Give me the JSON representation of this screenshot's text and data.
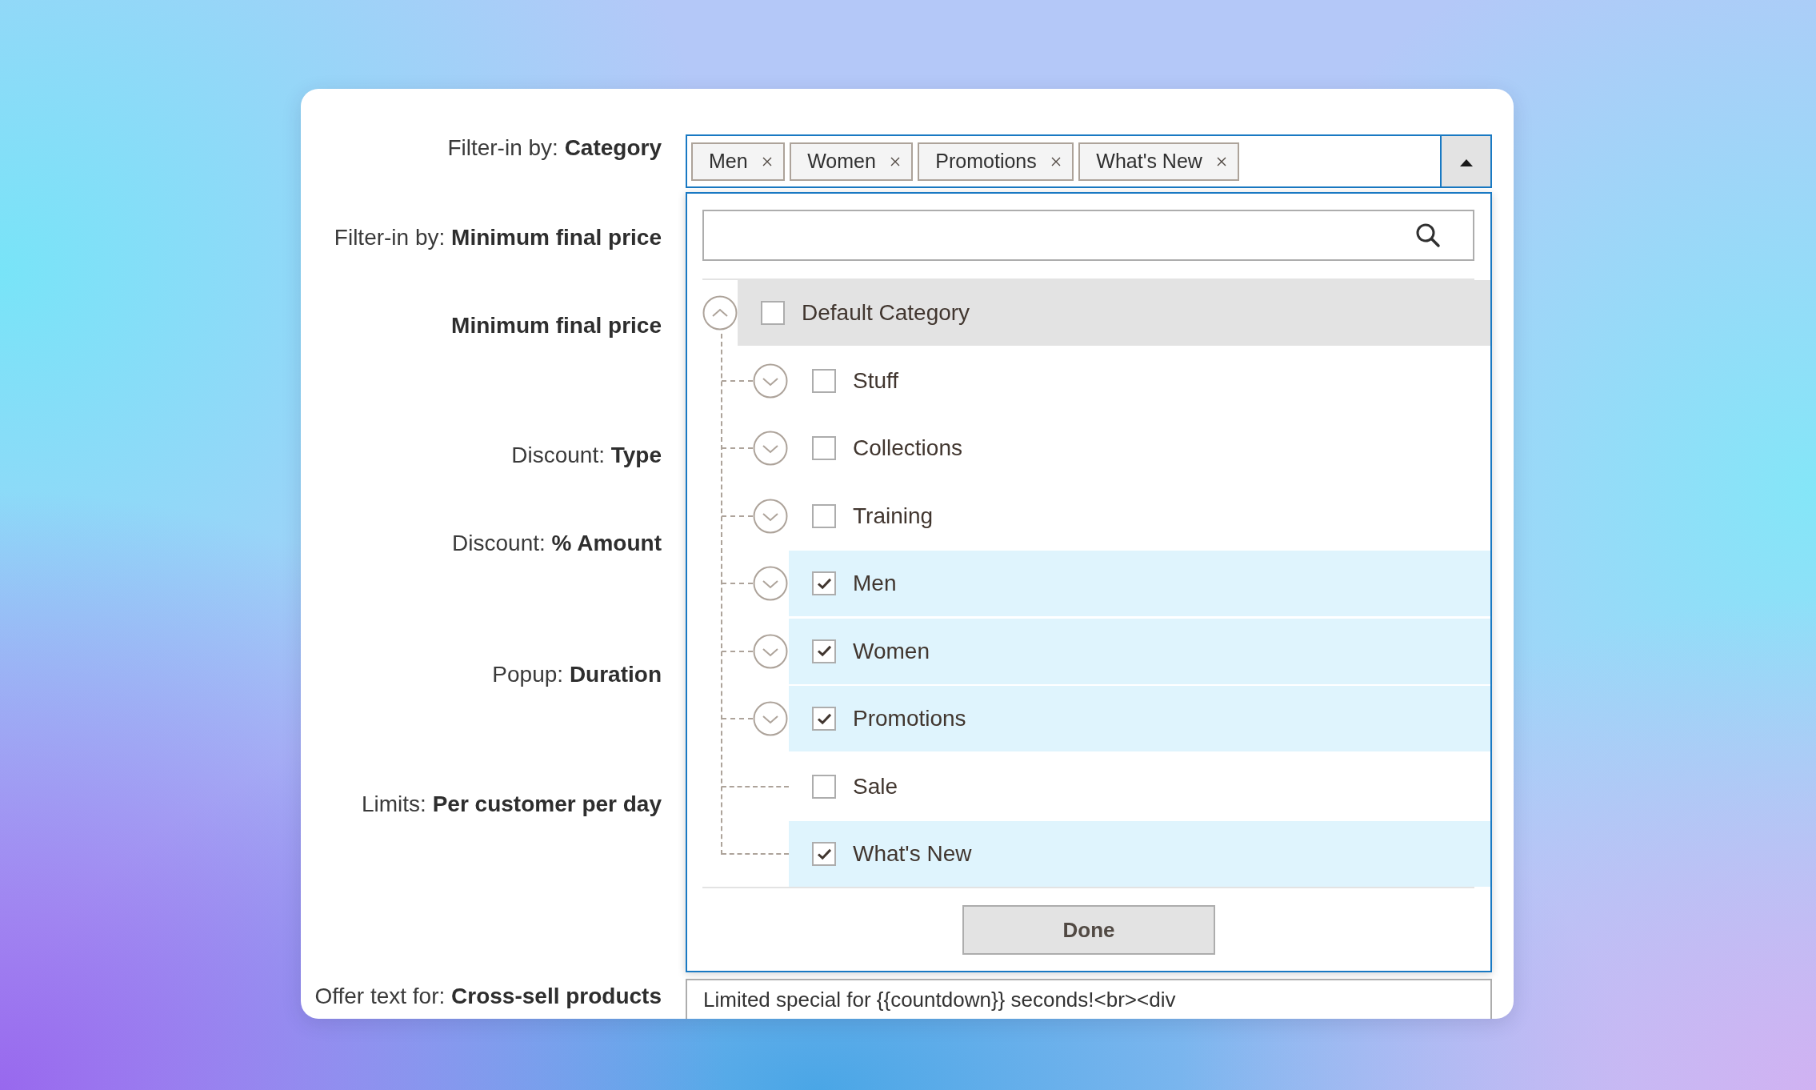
{
  "form_labels": [
    {
      "prefix": "Filter-in by:",
      "field": "Category"
    },
    {
      "prefix": "Filter-in by:",
      "field": "Minimum final price"
    },
    {
      "field": "Minimum final price"
    },
    {
      "prefix": "Discount:",
      "field": "Type"
    },
    {
      "prefix": "Discount:",
      "field": "% Amount"
    },
    {
      "prefix": "Popup:",
      "field": "Duration"
    },
    {
      "prefix": "Limits:",
      "field": "Per customer per day"
    },
    {
      "prefix": "Offer text for:",
      "field": "Cross-sell products"
    }
  ],
  "category_select": {
    "open": true,
    "tags": [
      {
        "label": "Men"
      },
      {
        "label": "Women"
      },
      {
        "label": "Promotions"
      },
      {
        "label": "What's New"
      }
    ]
  },
  "category_dropdown": {
    "tree": [
      {
        "label": "Default Category",
        "kind": "branch",
        "expanded": true,
        "checked": false,
        "focused": true,
        "children": [
          {
            "label": "Stuff",
            "kind": "branch",
            "expanded": false,
            "checked": false,
            "focused": false
          },
          {
            "label": "Collections",
            "kind": "branch",
            "expanded": false,
            "checked": false,
            "focused": false
          },
          {
            "label": "Training",
            "kind": "branch",
            "expanded": false,
            "checked": false,
            "focused": false
          },
          {
            "label": "Men",
            "kind": "branch",
            "expanded": false,
            "checked": true,
            "focused": false
          },
          {
            "label": "Women",
            "kind": "branch",
            "expanded": false,
            "checked": true,
            "focused": false
          },
          {
            "label": "Promotions",
            "kind": "branch",
            "expanded": false,
            "checked": true,
            "focused": false
          },
          {
            "label": "Sale",
            "kind": "leaf",
            "checked": false,
            "focused": false
          },
          {
            "label": "What's New",
            "kind": "leaf",
            "checked": true,
            "focused": false
          }
        ]
      }
    ],
    "done_button": "Done"
  },
  "offer_text_field": {
    "value": "Limited special for {{countdown}} seconds!<br><div"
  }
}
